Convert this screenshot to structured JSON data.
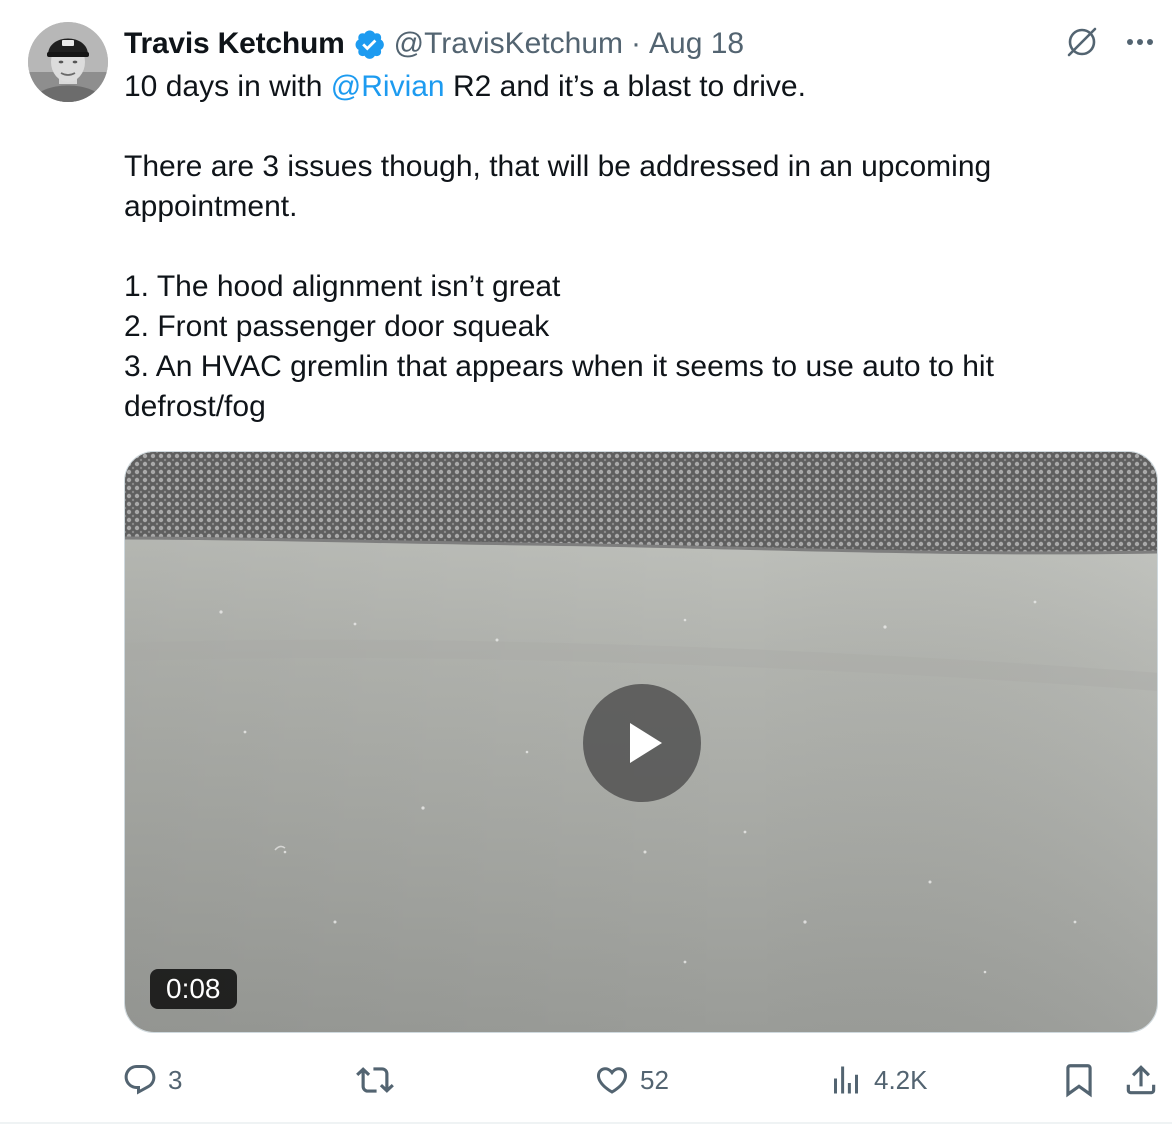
{
  "author": {
    "name": "Travis Ketchum",
    "handle": "@TravisKetchum",
    "separator": "·",
    "timestamp": "Aug 18",
    "verified_badge_icon": "verified-badge-icon",
    "verified_color": "#1d9bf0"
  },
  "post": {
    "line1_before": "10 days in with ",
    "mention": "@Rivian",
    "line1_after": " R2 and it’s a blast to drive.",
    "paragraph2": "There are 3 issues though, that will be addressed in an upcoming appointment.",
    "issues": [
      "1. The hood alignment isn’t great",
      "2. Front passenger door squeak",
      "3. An HVAC gremlin that appears when it seems to use auto to hit defrost/fog"
    ]
  },
  "media": {
    "type": "video",
    "duration": "0:08",
    "play_icon": "play-icon"
  },
  "actions": {
    "replies": "3",
    "reposts": "",
    "likes": "52",
    "views": "4.2K"
  },
  "icons": {
    "top_right": [
      "grok-icon",
      "more-options-icon"
    ],
    "bottom": [
      "reply-icon",
      "repost-icon",
      "like-icon",
      "views-icon",
      "bookmark-icon",
      "share-icon"
    ]
  },
  "colors": {
    "text": "#0f1419",
    "secondary": "#536471",
    "link": "#1d9bf0",
    "border": "#cfd9de"
  }
}
